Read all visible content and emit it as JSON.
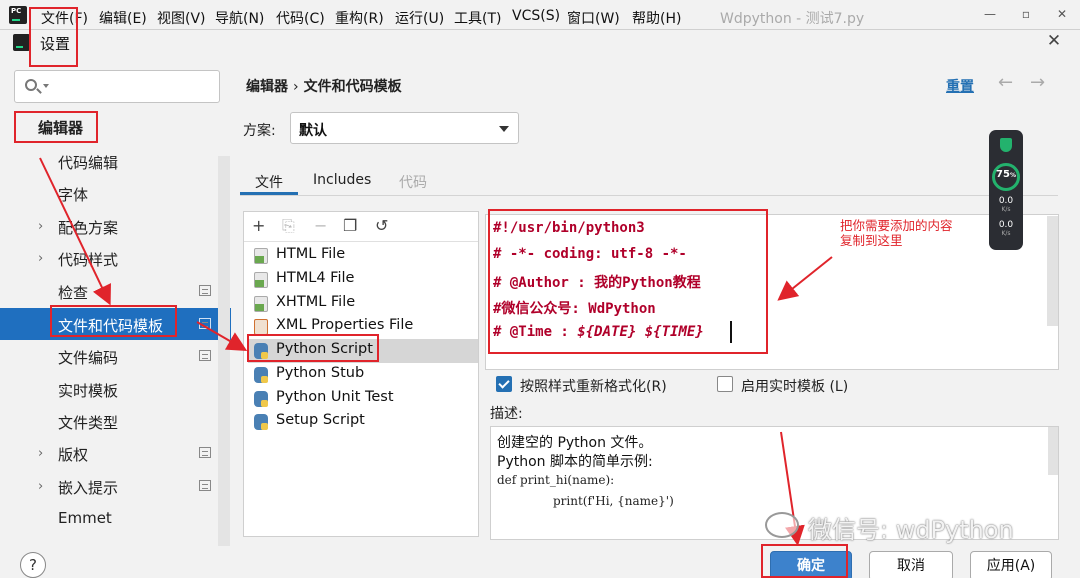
{
  "ide": {
    "logo_text": "PC",
    "menu": [
      "文件(F)",
      "编辑(E)",
      "视图(V)",
      "导航(N)",
      "代码(C)",
      "重构(R)",
      "运行(U)",
      "工具(T)",
      "VCS(S)",
      "窗口(W)",
      "帮助(H)"
    ],
    "window_title": "Wdpython - 测试7.py",
    "win_controls": [
      "—",
      "▫",
      "✕"
    ]
  },
  "dialog": {
    "title": "设置",
    "close_glyph": "✕"
  },
  "sidebar": {
    "search_placeholder": "",
    "items": [
      {
        "label": "编辑器",
        "chevron": "",
        "project_icon": false,
        "selected": false
      },
      {
        "label": "代码编辑",
        "chevron": "",
        "project_icon": false,
        "selected": false
      },
      {
        "label": "字体",
        "chevron": "",
        "project_icon": false,
        "selected": false
      },
      {
        "label": "配色方案",
        "chevron": "›",
        "project_icon": false,
        "selected": false
      },
      {
        "label": "代码样式",
        "chevron": "›",
        "project_icon": false,
        "selected": false
      },
      {
        "label": "检查",
        "chevron": "",
        "project_icon": true,
        "selected": false
      },
      {
        "label": "文件和代码模板",
        "chevron": "",
        "project_icon": true,
        "selected": true
      },
      {
        "label": "文件编码",
        "chevron": "",
        "project_icon": true,
        "selected": false
      },
      {
        "label": "实时模板",
        "chevron": "",
        "project_icon": false,
        "selected": false
      },
      {
        "label": "文件类型",
        "chevron": "",
        "project_icon": false,
        "selected": false
      },
      {
        "label": "版权",
        "chevron": "›",
        "project_icon": true,
        "selected": false
      },
      {
        "label": "嵌入提示",
        "chevron": "›",
        "project_icon": true,
        "selected": false
      },
      {
        "label": "Emmet",
        "chevron": "",
        "project_icon": false,
        "selected": false
      }
    ]
  },
  "breadcrumb": {
    "parent": "编辑器",
    "sep": "›",
    "current": "文件和代码模板"
  },
  "reset_label": "重置",
  "nav": {
    "back": "←",
    "forward": "→"
  },
  "scheme": {
    "label": "方案:",
    "value": "默认"
  },
  "tabs": [
    {
      "label": "文件",
      "active": true,
      "enabled": true
    },
    {
      "label": "Includes",
      "active": false,
      "enabled": true
    },
    {
      "label": "代码",
      "active": false,
      "enabled": false
    }
  ],
  "toolbar": {
    "add": "+",
    "copy_disabled": "⎘",
    "remove": "−",
    "duplicate": "❐",
    "reset": "↺"
  },
  "templates": [
    {
      "label": "HTML File",
      "icon": "html-file-icon",
      "type": "html"
    },
    {
      "label": "HTML4 File",
      "icon": "html-file-icon",
      "type": "html"
    },
    {
      "label": "XHTML File",
      "icon": "html-file-icon",
      "type": "html"
    },
    {
      "label": "XML Properties File",
      "icon": "xml-file-icon",
      "type": "xml"
    },
    {
      "label": "Python Script",
      "icon": "python-file-icon",
      "type": "py",
      "selected": true
    },
    {
      "label": "Python Stub",
      "icon": "python-file-icon",
      "type": "py"
    },
    {
      "label": "Python Unit Test",
      "icon": "python-file-icon",
      "type": "py"
    },
    {
      "label": "Setup Script",
      "icon": "python-file-icon",
      "type": "py"
    }
  ],
  "code": {
    "l1": "#!/usr/bin/python3",
    "l2": "# -*- coding: utf-8 -*-",
    "l3": "# @Author : 我的Python教程",
    "l4": "#微信公众号: WdPython",
    "l5_plain": "# @Time : ",
    "l5_italic": "${DATE} ${TIME}"
  },
  "annotation": {
    "line1": "把你需要添加的内容",
    "line2": "复制到这里"
  },
  "options": {
    "reformat_label": "按照样式重新格式化(R)",
    "reformat_checked": true,
    "live_label": "启用实时模板 (L)",
    "live_checked": false
  },
  "description": {
    "label": "描述:",
    "line1": "创建空的 Python 文件。",
    "line2": "Python 脚本的简单示例:",
    "code1": "def print_hi(name):",
    "code2": "print(f'Hi, {name}')"
  },
  "buttons": {
    "help": "?",
    "ok": "确定",
    "cancel": "取消",
    "apply": "应用(A)"
  },
  "net_monitor": {
    "percent": "75",
    "percent_unit": "%",
    "up": "0.0",
    "up_unit": "K/s",
    "down": "0.0",
    "down_unit": "K/s"
  },
  "watermark": "微信号: wdPython",
  "colors": {
    "accent": "#2470b3",
    "selection": "#1f6fbf",
    "annotation_red": "#e0242b",
    "code_red": "#b0002a"
  }
}
